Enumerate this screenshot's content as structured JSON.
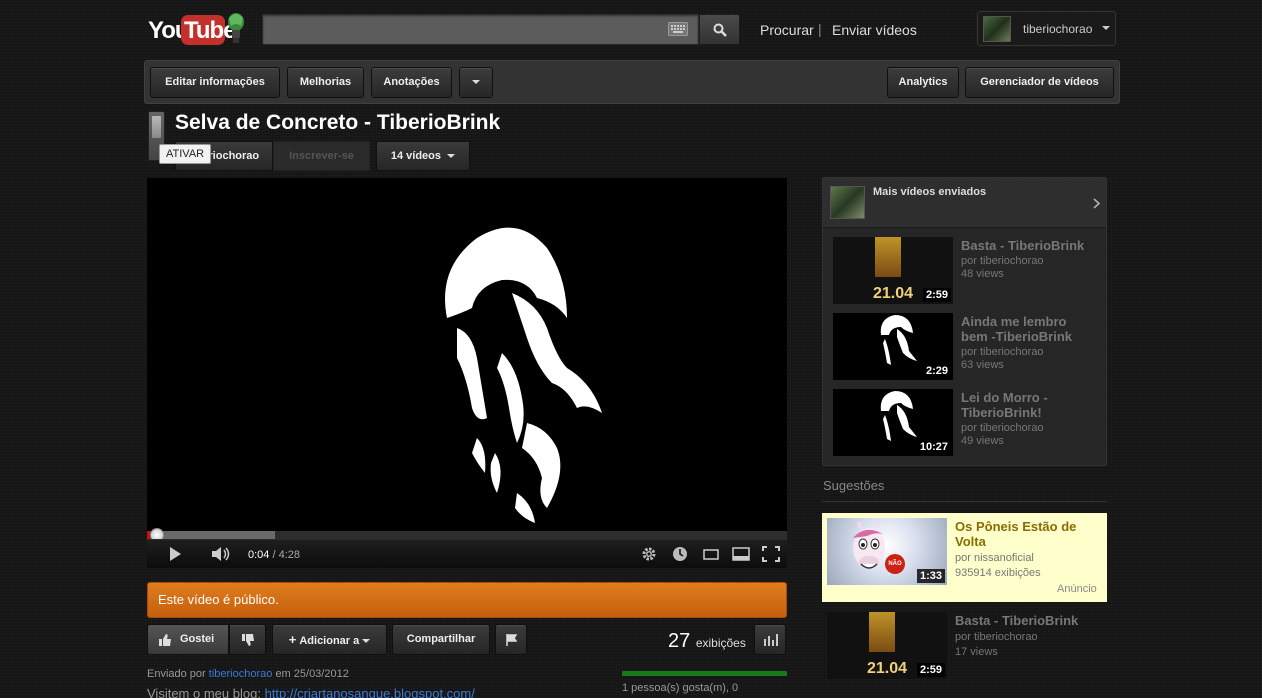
{
  "header": {
    "search_placeholder": "",
    "procurar": "Procurar",
    "separator": "|",
    "enviar": "Enviar vídeos",
    "username": "tiberiochorao"
  },
  "toolbar": {
    "editar": "Editar informações",
    "melhorias": "Melhorias",
    "anotacoes": "Anotações",
    "analytics": "Analytics",
    "gerenciador": "Gerenciador de vídeos"
  },
  "video": {
    "title": "Selva de Concreto - TiberioBrink",
    "channel": "tiberiochorao",
    "subscribe": "Inscrever-se",
    "video_count": "14 vídeos",
    "tooltip": "ATIVAR",
    "current_time": "0:04",
    "time_sep": " / ",
    "duration": "4:28",
    "progress_played": 0.015,
    "progress_buffered": 0.2,
    "public_notice": "Este vídeo é público."
  },
  "actions": {
    "like": "Gostei",
    "add_to": "Adicionar a",
    "share": "Compartilhar",
    "views_count": "27",
    "views_label": "exibições",
    "likes_text": "1 pessoa(s) gosta(m), 0",
    "uploaded_prefix": "Enviado por",
    "uploader": "tiberiochorao",
    "uploaded_date": "em 25/03/2012",
    "description_prefix": "Visitem o meu blog:",
    "description_link": "http://criartanosangue.blogspot.com/"
  },
  "sidebar": {
    "more_title": "Mais vídeos enviados",
    "more_videos": [
      {
        "title": "Basta - TiberioBrink",
        "by": "por tiberiochorao",
        "views": "48 views",
        "duration": "2:59"
      },
      {
        "title": "Ainda me lembro bem -TiberioBrink",
        "by": "por tiberiochorao",
        "views": "63 views",
        "duration": "2:29"
      },
      {
        "title": "Lei do Morro - TiberioBrink!",
        "by": "por tiberiochorao",
        "views": "49 views",
        "duration": "10:27"
      }
    ],
    "suggestions_label": "Sugestões",
    "ad": {
      "title": "Os Pôneis Estão de Volta",
      "by": "por nissanoficial",
      "views": "935914 exibições",
      "duration": "1:33",
      "badge": "Anúncio"
    },
    "suggestions": [
      {
        "title": "Basta - TiberioBrink",
        "by": "por tiberiochorao",
        "views": "17 views",
        "duration": "2:59"
      }
    ]
  },
  "thumb_text": {
    "date": "21.04",
    "nao": "NÃO"
  }
}
